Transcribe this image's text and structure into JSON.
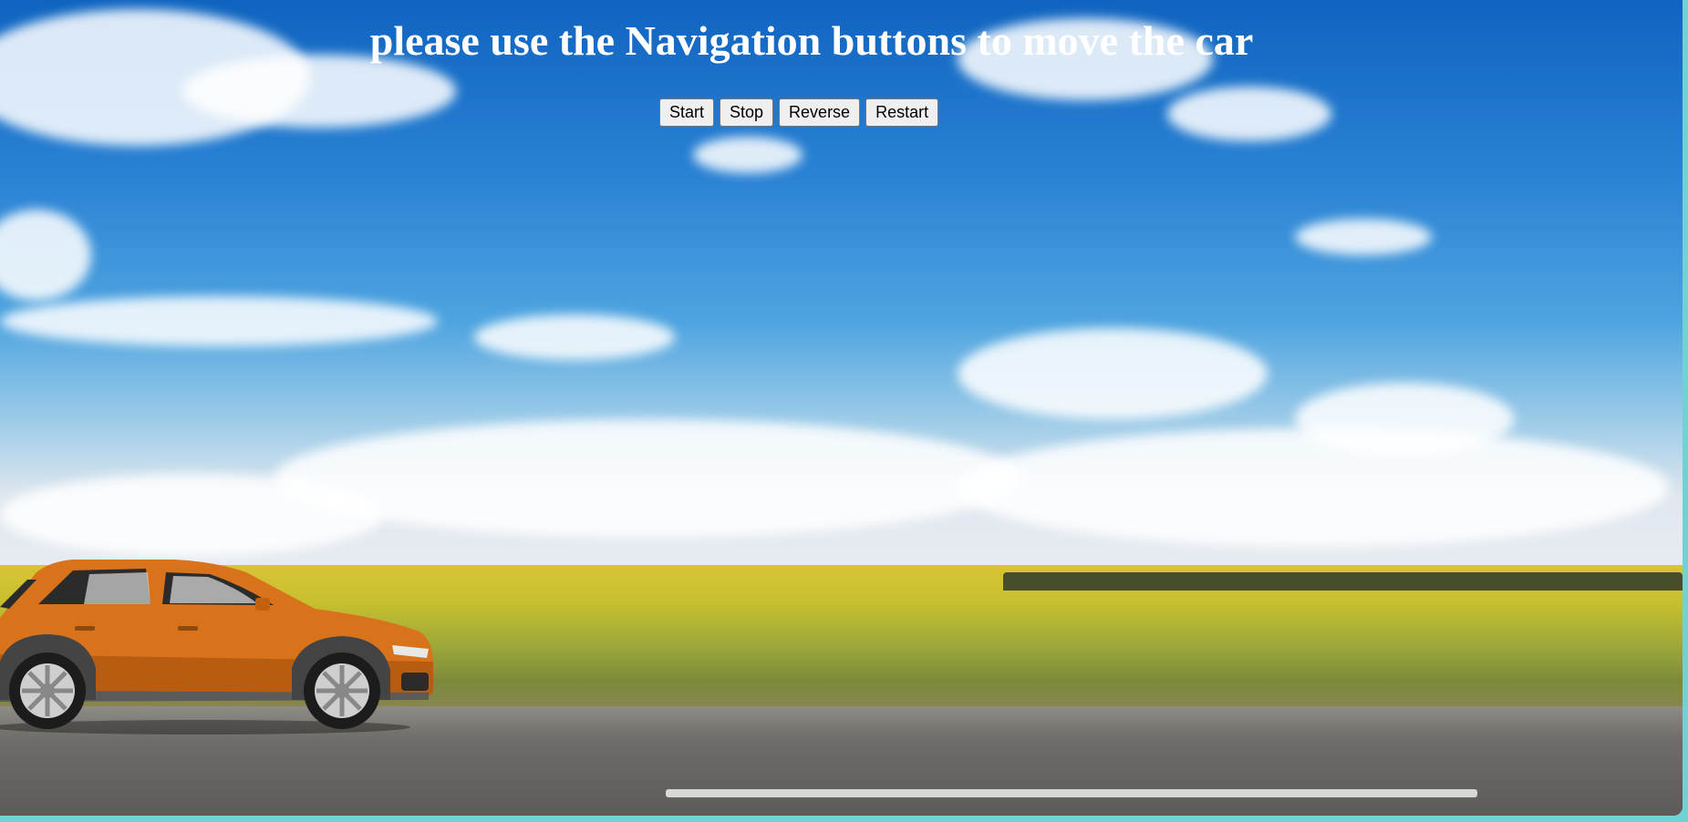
{
  "page": {
    "title": "please use the Navigation buttons to move the car"
  },
  "controls": {
    "start_label": "Start",
    "stop_label": "Stop",
    "reverse_label": "Reverse",
    "restart_label": "Restart"
  },
  "colors": {
    "car_body": "#d9731b",
    "border_accent": "#6fd3d3",
    "title_text": "#ffffff"
  }
}
